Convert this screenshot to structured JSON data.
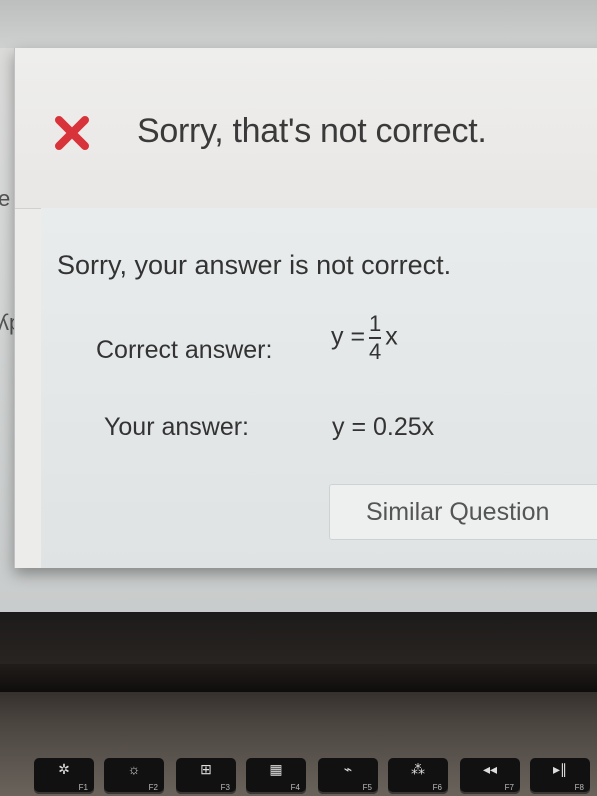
{
  "dialog": {
    "header_title": "Sorry, that's not correct.",
    "icon": "close-x-icon",
    "accent_color": "#d8333a"
  },
  "body": {
    "message": "Sorry, your answer is not correct.",
    "correct_label": "Correct answer:",
    "correct_prefix": "y =",
    "correct_num": "1",
    "correct_den": "4",
    "correct_suffix": "x",
    "your_label": "Your answer:",
    "your_value": "y = 0.25x"
  },
  "buttons": {
    "similar_question": "Similar Question"
  },
  "side": {
    "glyph_top": "e",
    "glyph_mid": "ʎp"
  },
  "keyboard": {
    "keys": [
      {
        "glyph": "✲",
        "fn": "F1"
      },
      {
        "glyph": "☼",
        "fn": "F2"
      },
      {
        "glyph": "⊞",
        "fn": "F3"
      },
      {
        "glyph": "▦",
        "fn": "F4"
      },
      {
        "glyph": "⌁",
        "fn": "F5"
      },
      {
        "glyph": "⁂",
        "fn": "F6"
      },
      {
        "glyph": "◂◂",
        "fn": "F7"
      },
      {
        "glyph": "▸∥",
        "fn": "F8"
      }
    ]
  }
}
